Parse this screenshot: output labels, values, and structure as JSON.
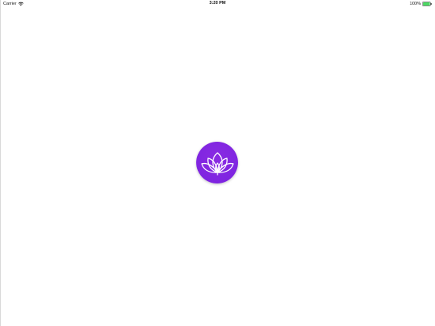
{
  "status_bar": {
    "carrier": "Carrier",
    "time": "3:20 PM",
    "battery_percent": "100%",
    "wifi_icon": "wifi-icon",
    "battery_icon": "battery-icon",
    "battery_level": 1.0,
    "battery_color": "#4cd964"
  },
  "splash": {
    "logo_icon": "lotus-icon",
    "logo_color": "#8a2be2",
    "logo_gradient_end": "#7a22e0",
    "logo_line_color": "#ffffff"
  }
}
